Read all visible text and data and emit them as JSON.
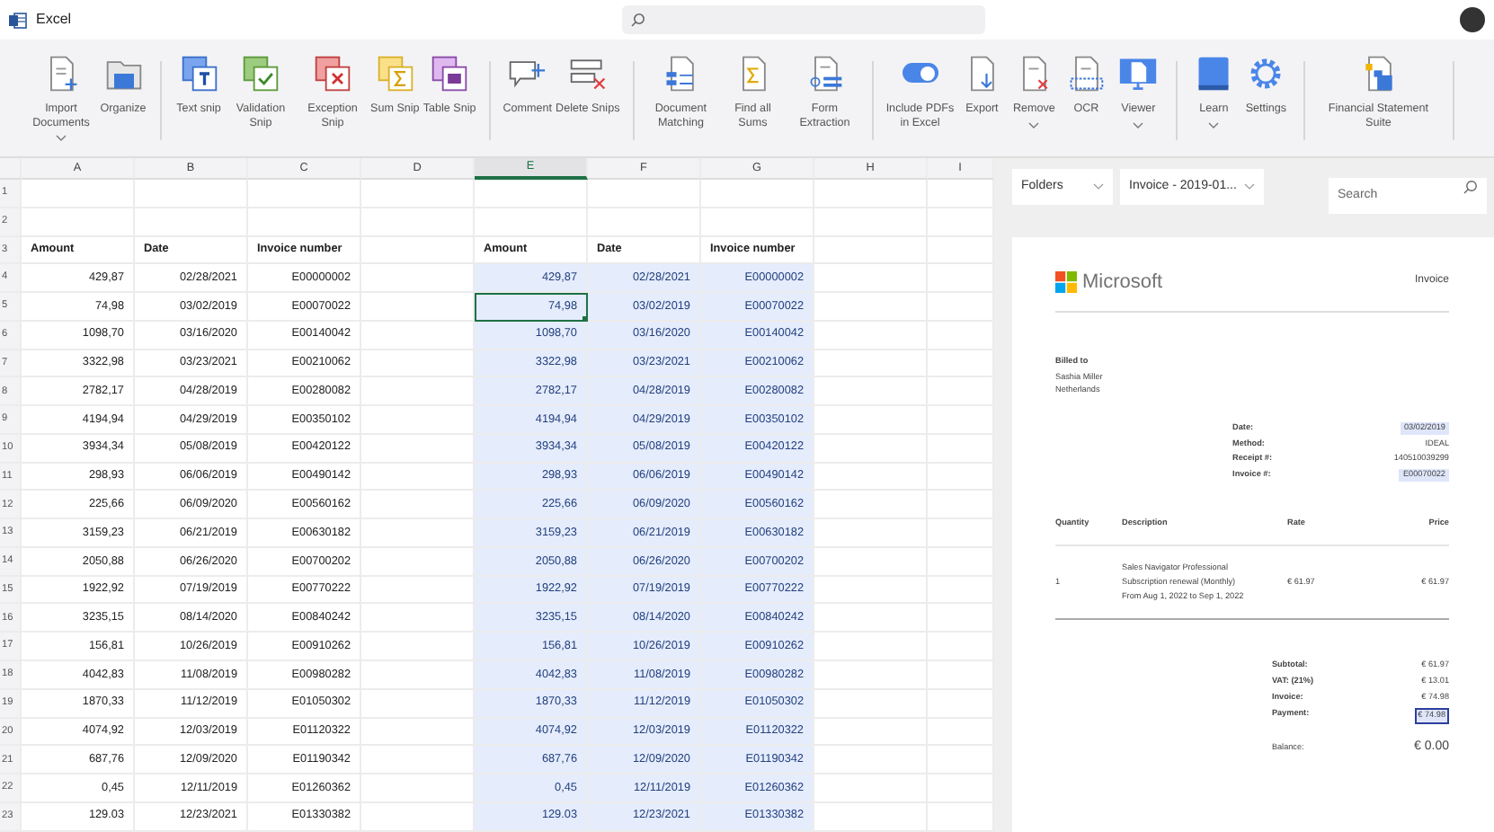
{
  "window": {
    "title": "Excel"
  },
  "ribbon": {
    "groups": [
      {
        "items": [
          {
            "label": "Import Documents",
            "kind": "button",
            "dropdown": true
          },
          {
            "label": "Organize",
            "kind": "button",
            "dropdown": false
          }
        ]
      },
      {
        "items": [
          {
            "label": "Text snip",
            "kind": "button",
            "dropdown": false
          },
          {
            "label": "Validation Snip",
            "kind": "button",
            "dropdown": false
          },
          {
            "label": "Exception Snip",
            "kind": "button",
            "dropdown": false
          },
          {
            "label": "Sum Snip",
            "kind": "button",
            "dropdown": false
          },
          {
            "label": "Table Snip",
            "kind": "button",
            "dropdown": false
          }
        ]
      },
      {
        "items": [
          {
            "label": "Comment",
            "kind": "button",
            "dropdown": false
          },
          {
            "label": "Delete Snips",
            "kind": "button",
            "dropdown": false
          }
        ]
      },
      {
        "items": [
          {
            "label": "Document Matching",
            "kind": "button",
            "dropdown": false
          },
          {
            "label": "Find all Sums",
            "kind": "button",
            "dropdown": false
          },
          {
            "label": "Form Extraction",
            "kind": "button",
            "dropdown": false
          }
        ]
      },
      {
        "items": [
          {
            "label": "Include PDFs in Excel",
            "kind": "toggle",
            "on": true,
            "dropdown": false
          },
          {
            "label": "Export",
            "kind": "button",
            "dropdown": false
          },
          {
            "label": "Remove",
            "kind": "button",
            "dropdown": true
          },
          {
            "label": "OCR",
            "kind": "button",
            "dropdown": false
          },
          {
            "label": "Viewer",
            "kind": "button",
            "dropdown": true
          }
        ]
      },
      {
        "items": [
          {
            "label": "Learn",
            "kind": "button",
            "dropdown": true
          },
          {
            "label": "Settings",
            "kind": "button",
            "dropdown": false
          }
        ]
      },
      {
        "items": [
          {
            "label": "Financial Statement Suite",
            "kind": "button",
            "dropdown": false
          }
        ]
      }
    ]
  },
  "sheet": {
    "column_headers": [
      {
        "label": "A",
        "selected": false
      },
      {
        "label": "B",
        "selected": false
      },
      {
        "label": "C",
        "selected": false
      },
      {
        "label": "D",
        "selected": false
      },
      {
        "label": "E",
        "selected": true
      },
      {
        "label": "F",
        "selected": false
      },
      {
        "label": "G",
        "selected": false
      },
      {
        "label": "H",
        "selected": false
      },
      {
        "label": "I",
        "selected": false
      }
    ],
    "row_numbers": [
      "1",
      "2",
      "3",
      "4",
      "5",
      "6",
      "7",
      "8",
      "9",
      "10",
      "11",
      "12",
      "13",
      "14",
      "15",
      "16",
      "17",
      "18",
      "19",
      "20",
      "21",
      "22",
      "23"
    ],
    "tables": [
      {
        "highlighted": false,
        "columns": [
          "Amount",
          "Date",
          "Invoice number"
        ],
        "rows": [
          {
            "cells": [
              "429,87",
              "02/28/2021",
              "E00000002"
            ],
            "selected": false
          },
          {
            "cells": [
              "74,98",
              "03/02/2019",
              "E00070022"
            ],
            "selected": false
          },
          {
            "cells": [
              "1098,70",
              "03/16/2020",
              "E00140042"
            ],
            "selected": false
          },
          {
            "cells": [
              "3322,98",
              "03/23/2021",
              "E00210062"
            ],
            "selected": false
          },
          {
            "cells": [
              "2782,17",
              "04/28/2019",
              "E00280082"
            ],
            "selected": false
          },
          {
            "cells": [
              "4194,94",
              "04/29/2019",
              "E00350102"
            ],
            "selected": false
          },
          {
            "cells": [
              "3934,34",
              "05/08/2019",
              "E00420122"
            ],
            "selected": false
          },
          {
            "cells": [
              "298,93",
              "06/06/2019",
              "E00490142"
            ],
            "selected": false
          },
          {
            "cells": [
              "225,66",
              "06/09/2020",
              "E00560162"
            ],
            "selected": false
          },
          {
            "cells": [
              "3159,23",
              "06/21/2019",
              "E00630182"
            ],
            "selected": false
          },
          {
            "cells": [
              "2050,88",
              "06/26/2020",
              "E00700202"
            ],
            "selected": false
          },
          {
            "cells": [
              "1922,92",
              "07/19/2019",
              "E00770222"
            ],
            "selected": false
          },
          {
            "cells": [
              "3235,15",
              "08/14/2020",
              "E00840242"
            ],
            "selected": false
          },
          {
            "cells": [
              "156,81",
              "10/26/2019",
              "E00910262"
            ],
            "selected": false
          },
          {
            "cells": [
              "4042,83",
              "11/08/2019",
              "E00980282"
            ],
            "selected": false
          },
          {
            "cells": [
              "1870,33",
              "11/12/2019",
              "E01050302"
            ],
            "selected": false
          },
          {
            "cells": [
              "4074,92",
              "12/03/2019",
              "E01120322"
            ],
            "selected": false
          },
          {
            "cells": [
              "687,76",
              "12/09/2020",
              "E01190342"
            ],
            "selected": false
          },
          {
            "cells": [
              "0,45",
              "12/11/2019",
              "E01260362"
            ],
            "selected": false
          },
          {
            "cells": [
              "129.03",
              "12/23/2021",
              "E01330382"
            ],
            "selected": false
          }
        ]
      },
      {
        "highlighted": true,
        "columns": [
          "Amount",
          "Date",
          "Invoice number"
        ],
        "rows": [
          {
            "cells": [
              "429,87",
              "02/28/2021",
              "E00000002"
            ],
            "selected": false
          },
          {
            "cells": [
              "74,98",
              "03/02/2019",
              "E00070022"
            ],
            "selected": true
          },
          {
            "cells": [
              "1098,70",
              "03/16/2020",
              "E00140042"
            ],
            "selected": false
          },
          {
            "cells": [
              "3322,98",
              "03/23/2021",
              "E00210062"
            ],
            "selected": false
          },
          {
            "cells": [
              "2782,17",
              "04/28/2019",
              "E00280082"
            ],
            "selected": false
          },
          {
            "cells": [
              "4194,94",
              "04/29/2019",
              "E00350102"
            ],
            "selected": false
          },
          {
            "cells": [
              "3934,34",
              "05/08/2019",
              "E00420122"
            ],
            "selected": false
          },
          {
            "cells": [
              "298,93",
              "06/06/2019",
              "E00490142"
            ],
            "selected": false
          },
          {
            "cells": [
              "225,66",
              "06/09/2020",
              "E00560162"
            ],
            "selected": false
          },
          {
            "cells": [
              "3159,23",
              "06/21/2019",
              "E00630182"
            ],
            "selected": false
          },
          {
            "cells": [
              "2050,88",
              "06/26/2020",
              "E00700202"
            ],
            "selected": false
          },
          {
            "cells": [
              "1922,92",
              "07/19/2019",
              "E00770222"
            ],
            "selected": false
          },
          {
            "cells": [
              "3235,15",
              "08/14/2020",
              "E00840242"
            ],
            "selected": false
          },
          {
            "cells": [
              "156,81",
              "10/26/2019",
              "E00910262"
            ],
            "selected": false
          },
          {
            "cells": [
              "4042,83",
              "11/08/2019",
              "E00980282"
            ],
            "selected": false
          },
          {
            "cells": [
              "1870,33",
              "11/12/2019",
              "E01050302"
            ],
            "selected": false
          },
          {
            "cells": [
              "4074,92",
              "12/03/2019",
              "E01120322"
            ],
            "selected": false
          },
          {
            "cells": [
              "687,76",
              "12/09/2020",
              "E01190342"
            ],
            "selected": false
          },
          {
            "cells": [
              "0,45",
              "12/11/2019",
              "E01260362"
            ],
            "selected": false
          },
          {
            "cells": [
              "129.03",
              "12/23/2021",
              "E01330382"
            ],
            "selected": false
          }
        ]
      }
    ]
  },
  "viewer": {
    "folder_select": "Folders",
    "document_select": "Invoice - 2019-01...",
    "search": {
      "placeholder": "Search"
    },
    "invoice": {
      "logo_text": "Microsoft",
      "doc_title": "Invoice",
      "billed_to_label": "Billed to",
      "billed_to_lines": [
        "Sashia Miller",
        "Netherlands"
      ],
      "details": [
        {
          "label": "Date:",
          "value": "03/02/2019",
          "highlighted": true
        },
        {
          "label": "Method:",
          "value": "IDEAL",
          "highlighted": false
        },
        {
          "label": "Receipt #:",
          "value": "140510039299",
          "highlighted": false
        },
        {
          "label": "Invoice #:",
          "value": "E00070022",
          "highlighted": true
        }
      ],
      "item_columns": [
        "Quantity",
        "Description",
        "Rate",
        "Price"
      ],
      "items": [
        {
          "quantity": "1",
          "description_lines": [
            "Sales Navigator Professional",
            "Subscription renewal (Monthly)",
            "From Aug 1, 2022 to Sep 1, 2022"
          ],
          "rate": "€ 61.97",
          "price": "€ 61.97"
        }
      ],
      "totals": [
        {
          "label": "Subtotal:",
          "value": "€ 61.97",
          "highlighted": false
        },
        {
          "label": "VAT: (21%)",
          "value": "€ 13.01",
          "highlighted": false
        },
        {
          "label": "Invoice:",
          "value": "€ 74.98",
          "highlighted": false
        },
        {
          "label": "Payment:",
          "value": "€ 74.98",
          "highlighted": true
        }
      ],
      "balance": {
        "label": "Balance:",
        "value": "€ 0.00"
      }
    }
  }
}
